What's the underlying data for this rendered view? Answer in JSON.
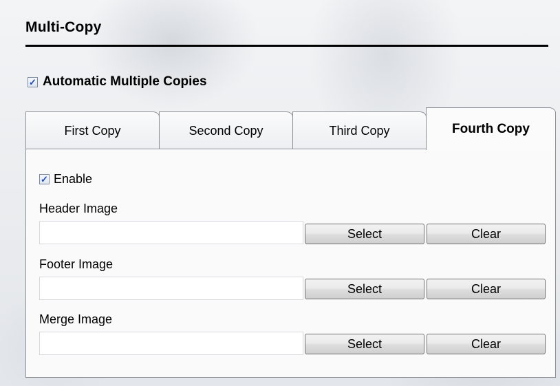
{
  "section": {
    "title": "Multi-Copy"
  },
  "automatic": {
    "label": "Automatic Multiple Copies",
    "checked": true
  },
  "tabs": [
    {
      "label": "First Copy",
      "active": false
    },
    {
      "label": "Second Copy",
      "active": false
    },
    {
      "label": "Third Copy",
      "active": false
    },
    {
      "label": "Fourth Copy",
      "active": true
    }
  ],
  "panel": {
    "enable": {
      "label": "Enable",
      "checked": true
    },
    "header_image": {
      "label": "Header Image",
      "value": "",
      "select_label": "Select",
      "clear_label": "Clear"
    },
    "footer_image": {
      "label": "Footer Image",
      "value": "",
      "select_label": "Select",
      "clear_label": "Clear"
    },
    "merge_image": {
      "label": "Merge Image",
      "value": "",
      "select_label": "Select",
      "clear_label": "Clear"
    }
  },
  "icons": {
    "checkmark": "check-icon"
  },
  "colors": {
    "check_mark": "#1a47b8",
    "rule": "#000000"
  }
}
